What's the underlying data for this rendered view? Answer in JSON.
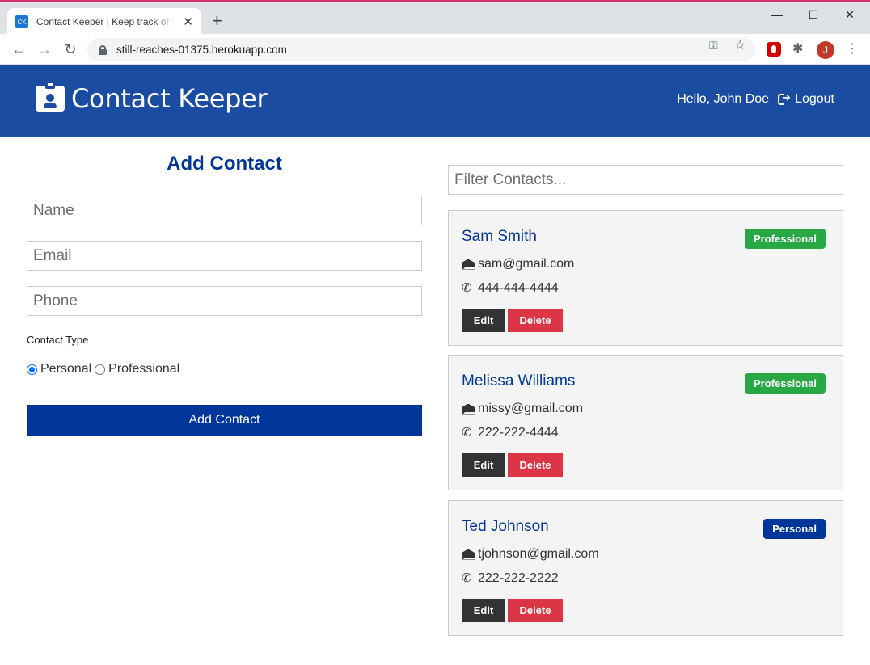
{
  "browser": {
    "tab_favicon": "CK",
    "tab_title": "Contact Keeper | Keep track of your contacts",
    "tab_close": "✕",
    "new_tab": "+",
    "url": "still-reaches-01375.herokuapp.com",
    "profile_initial": "J"
  },
  "navbar": {
    "brand": "Contact Keeper",
    "greeting": "Hello, John Doe",
    "logout": "Logout",
    "color": "#1a4da1"
  },
  "form": {
    "title": "Add Contact",
    "name_placeholder": "Name",
    "email_placeholder": "Email",
    "phone_placeholder": "Phone",
    "type_label": "Contact Type",
    "type_options": [
      "Personal",
      "Professional"
    ],
    "selected_type": "Personal",
    "submit": "Add Contact"
  },
  "filter": {
    "placeholder": "Filter Contacts..."
  },
  "contacts": [
    {
      "name": "Sam Smith",
      "email": "sam@gmail.com",
      "phone": "444-444-4444",
      "type": "Professional"
    },
    {
      "name": "Melissa Williams",
      "email": "missy@gmail.com",
      "phone": "222-222-4444",
      "type": "Professional"
    },
    {
      "name": "Ted Johnson",
      "email": "tjohnson@gmail.com",
      "phone": "222-222-2222",
      "type": "Personal"
    }
  ],
  "card_actions": {
    "edit": "Edit",
    "delete": "Delete"
  },
  "colors": {
    "primary": "#003699",
    "success": "#28a745",
    "danger": "#dc3545",
    "dark": "#333333"
  }
}
